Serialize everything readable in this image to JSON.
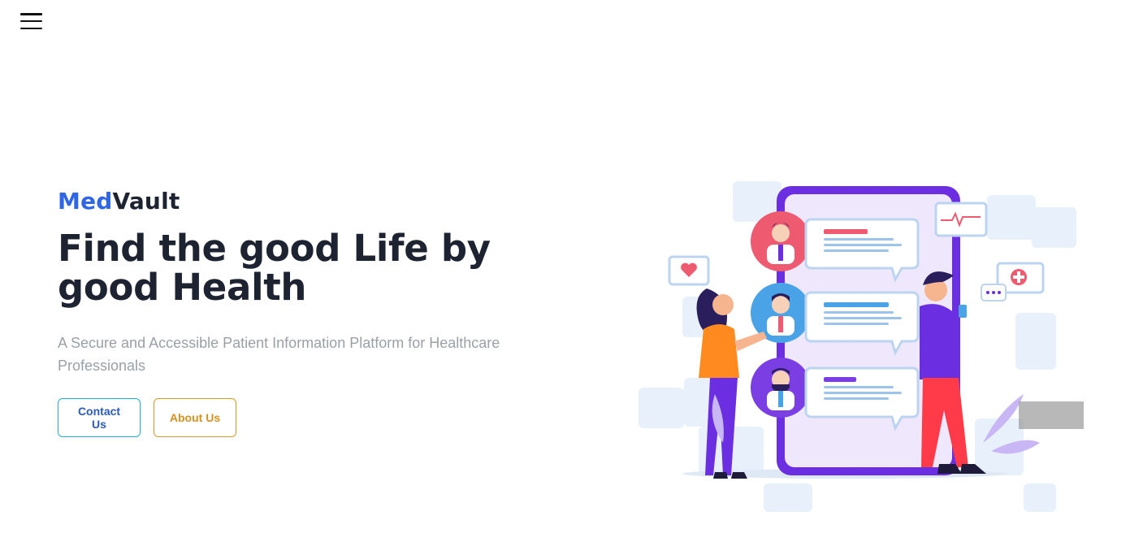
{
  "nav": {
    "menu_icon": "hamburger-menu-icon"
  },
  "hero": {
    "brand_part1": "Med",
    "brand_part2": "Vault",
    "headline": "Find the good Life by good Health",
    "subtitle": "A Secure and Accessible Patient Information Platform for Healthcare Professionals",
    "contact_label": "Contact Us",
    "about_label": "About Us"
  },
  "illustration": {
    "icon": "telemedicine-illustration"
  },
  "colors": {
    "brand_blue": "#2f66e6",
    "dark_text": "#1d2330",
    "contact_border": "#1eb0d8",
    "about_border": "#d99a2a",
    "phone_purple": "#6b2ee0"
  }
}
